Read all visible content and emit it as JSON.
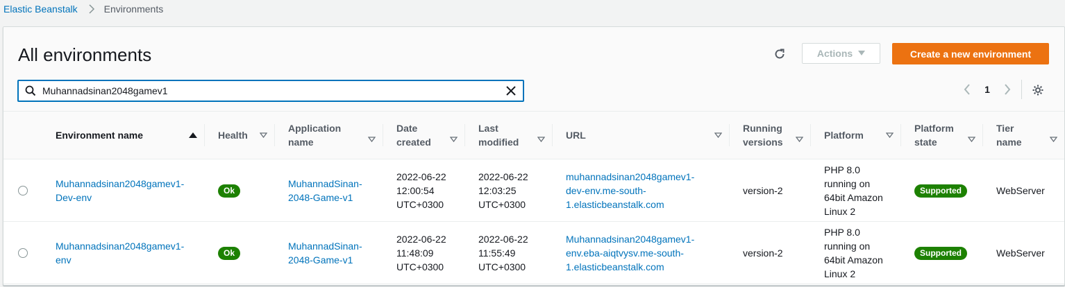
{
  "breadcrumb": {
    "items": [
      {
        "label": "Elastic Beanstalk"
      },
      {
        "label": "Environments"
      }
    ]
  },
  "header": {
    "title": "All environments",
    "actions_label": "Actions",
    "create_label": "Create a new environment"
  },
  "search": {
    "value": "Muhannadsinan2048gamev1"
  },
  "pagination": {
    "current_page": "1"
  },
  "colors": {
    "primary": "#ec7211",
    "link": "#0073bb",
    "success": "#1d8102"
  },
  "table": {
    "columns": {
      "name": "Environment name",
      "health": "Health",
      "application": [
        "Application",
        "name"
      ],
      "date_created": [
        "Date",
        "created"
      ],
      "last_modified": [
        "Last",
        "modified"
      ],
      "url": "URL",
      "running_versions": [
        "Running",
        "versions"
      ],
      "platform": "Platform",
      "platform_state": [
        "Platform",
        "state"
      ],
      "tier": [
        "Tier",
        "name"
      ]
    },
    "sort": {
      "column": "Environment name",
      "direction": "ascending"
    },
    "rows": [
      {
        "name": [
          "Muhannadsinan2048gamev1-",
          "Dev-env"
        ],
        "health": "Ok",
        "application": [
          "MuhannadSinan-",
          "2048-Game-v1"
        ],
        "date_created": [
          "2022-06-22",
          "12:00:54",
          "UTC+0300"
        ],
        "last_modified": [
          "2022-06-22",
          "12:03:25",
          "UTC+0300"
        ],
        "url": [
          "muhannadsinan2048gamev1-",
          "dev-env.me-south-",
          "1.elasticbeanstalk.com"
        ],
        "running_versions": "version-2",
        "platform": [
          "PHP 8.0",
          "running on",
          "64bit Amazon",
          "Linux 2"
        ],
        "platform_state": "Supported",
        "tier": "WebServer"
      },
      {
        "name": [
          "Muhannadsinan2048gamev1-",
          "env"
        ],
        "health": "Ok",
        "application": [
          "MuhannadSinan-",
          "2048-Game-v1"
        ],
        "date_created": [
          "2022-06-22",
          "11:48:09",
          "UTC+0300"
        ],
        "last_modified": [
          "2022-06-22",
          "11:55:49",
          "UTC+0300"
        ],
        "url": [
          "Muhannadsinan2048gamev1-",
          "env.eba-aiqtvysv.me-south-",
          "1.elasticbeanstalk.com"
        ],
        "running_versions": "version-2",
        "platform": [
          "PHP 8.0",
          "running on",
          "64bit Amazon",
          "Linux 2"
        ],
        "platform_state": "Supported",
        "tier": "WebServer"
      }
    ]
  }
}
